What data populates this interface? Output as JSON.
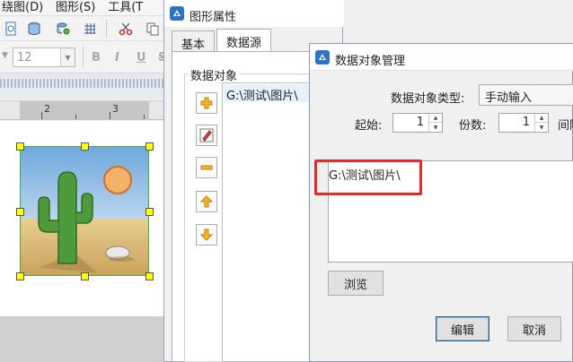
{
  "app": {
    "menu": [
      "绕图(D)",
      "图形(S)",
      "工具(T"
    ],
    "font_size": "12",
    "format_buttons": [
      "B",
      "I",
      "U",
      "S"
    ],
    "ruler_labels": [
      "2",
      "3"
    ]
  },
  "properties_dialog": {
    "title": "图形属性",
    "tabs": [
      "基本",
      "数据源"
    ],
    "group_label": "数据对象",
    "list_items": [
      "G:\\测试\\图片\\"
    ]
  },
  "data_object_dialog": {
    "title": "数据对象管理",
    "type_label": "数据对象类型:",
    "type_value": "手动输入",
    "start_label": "起始:",
    "start_value": "1",
    "copies_label": "份数:",
    "copies_value": "1",
    "interval_label": "间隔",
    "content": "G:\\测试\\图片\\",
    "browse_label": "浏览",
    "edit_label": "编辑",
    "cancel_label": "取消"
  },
  "colors": {
    "highlight": "#e02b2b",
    "selection_handle": "#ffff00",
    "frame_border": "#3fae3f"
  }
}
